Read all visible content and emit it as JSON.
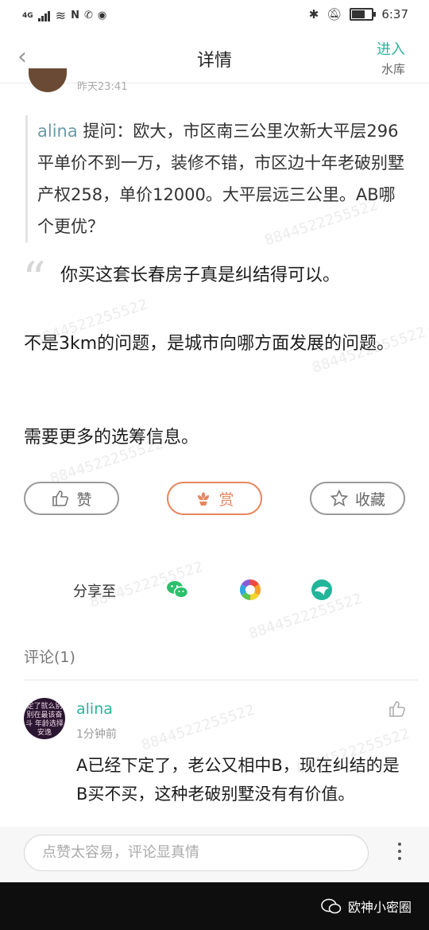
{
  "status_bar": {
    "network": "4G",
    "time": "6:37"
  },
  "header": {
    "title": "详情",
    "enter_label": "进入",
    "group_name": "水库"
  },
  "post": {
    "author_time": "昨天23:41",
    "quoted_name": "alina",
    "quoted_text": " 提问：欧大，市区南三公里次新大平层296平单价不到一万，装修不错，市区边十年老破别墅产权258，单价12000。大平层远三公里。AB哪个更优？",
    "reply_lines": [
      "你买这套长春房子真是纠结得可以。",
      "不是3km的问题，是城市向哪方面发展的问题。",
      "需要更多的选筹信息。"
    ]
  },
  "actions": {
    "like_label": "赞",
    "reward_label": "赏",
    "favorite_label": "收藏"
  },
  "share": {
    "label": "分享至",
    "targets": [
      "wechat-icon",
      "moments-icon",
      "app-share-icon"
    ]
  },
  "comments": {
    "title": "评论(1)",
    "items": [
      {
        "user": "alina",
        "time": "1分钟前",
        "text": "A已经下定了，老公又相中B，现在纠结的是B买不买，这种老破别墅没有有价值。",
        "avatar_text": "定了就么别 别在最该奋斗 年龄选择安逸"
      }
    ]
  },
  "comment_input": {
    "placeholder": "点赞太容易，评论显真情"
  },
  "footer": {
    "brand": "欧神小密圈"
  },
  "watermark": "8844522255522",
  "colors": {
    "accent": "#2bb39a",
    "reward": "#e6865e",
    "quote_name": "#6a9aa8"
  }
}
